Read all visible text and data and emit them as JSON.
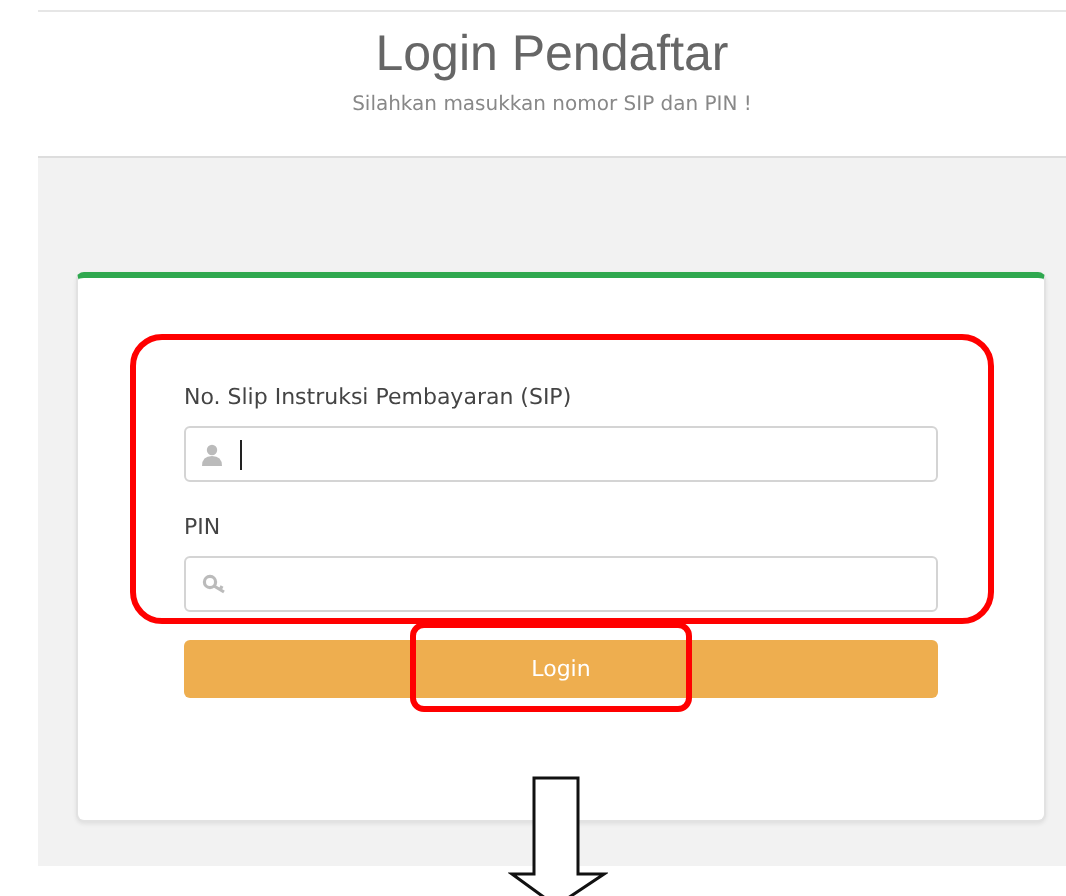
{
  "header": {
    "title": "Login Pendaftar",
    "subtitle": "Silahkan masukkan nomor SIP dan PIN !"
  },
  "fields": [
    {
      "label": "No. Slip Instruksi Pembayaran (SIP)",
      "kind": "user",
      "focused": true
    },
    {
      "label": "PIN",
      "kind": "key",
      "focused": false
    }
  ],
  "button": {
    "label": "Login"
  }
}
